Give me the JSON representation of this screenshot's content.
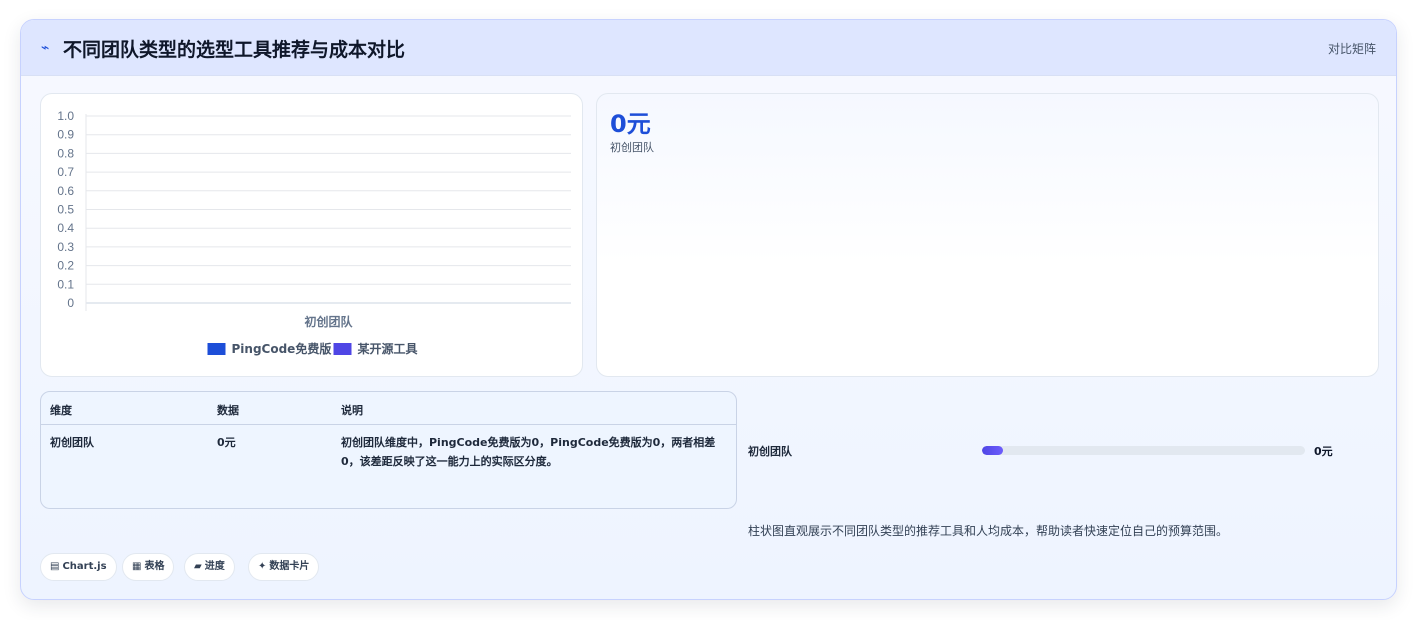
{
  "header": {
    "icon": "pulse-icon",
    "title": "不同团队类型的选型工具推荐与成本对比",
    "right_label": "对比矩阵"
  },
  "chart_data": {
    "type": "bar",
    "categories": [
      "初创团队"
    ],
    "series": [
      {
        "name": "PingCode免费版",
        "values": [
          0
        ],
        "color": "#1d4ed8"
      },
      {
        "name": "某开源工具",
        "values": [
          0
        ],
        "color": "#4f46e5"
      }
    ],
    "ylim": [
      0,
      1.0
    ],
    "yticks": [
      "0",
      "0.1",
      "0.2",
      "0.3",
      "0.4",
      "0.5",
      "0.6",
      "0.7",
      "0.8",
      "0.9",
      "1.0"
    ],
    "grid": true,
    "legend": "bottom"
  },
  "kpi": {
    "value": "0元",
    "label": "初创团队"
  },
  "table": {
    "headers": [
      "维度",
      "数据",
      "说明"
    ],
    "rows": [
      {
        "dimension": "初创团队",
        "value": "0元",
        "note": "初创团队维度中，PingCode免费版为0，PingCode免费版为0，两者相差0，该差距反映了这一能力上的实际区分度。"
      }
    ]
  },
  "progress": {
    "label": "初创团队",
    "value_text": "0元",
    "fraction": 0
  },
  "caption": "柱状图直观展示不同团队类型的推荐工具和人均成本，帮助读者快速定位自己的预算范围。",
  "chips": [
    {
      "icon": "chart-icon",
      "glyph": "▤",
      "label": "Chart.js"
    },
    {
      "icon": "table-icon",
      "glyph": "▦",
      "label": "表格"
    },
    {
      "icon": "progress-icon",
      "glyph": "▰",
      "label": "进度"
    },
    {
      "icon": "sparkle-icon",
      "glyph": "✦",
      "label": "数据卡片"
    }
  ],
  "colors": {
    "accent": "#1d4ed8",
    "accent2": "#4f46e5",
    "header_bg": "#dee6ff"
  }
}
